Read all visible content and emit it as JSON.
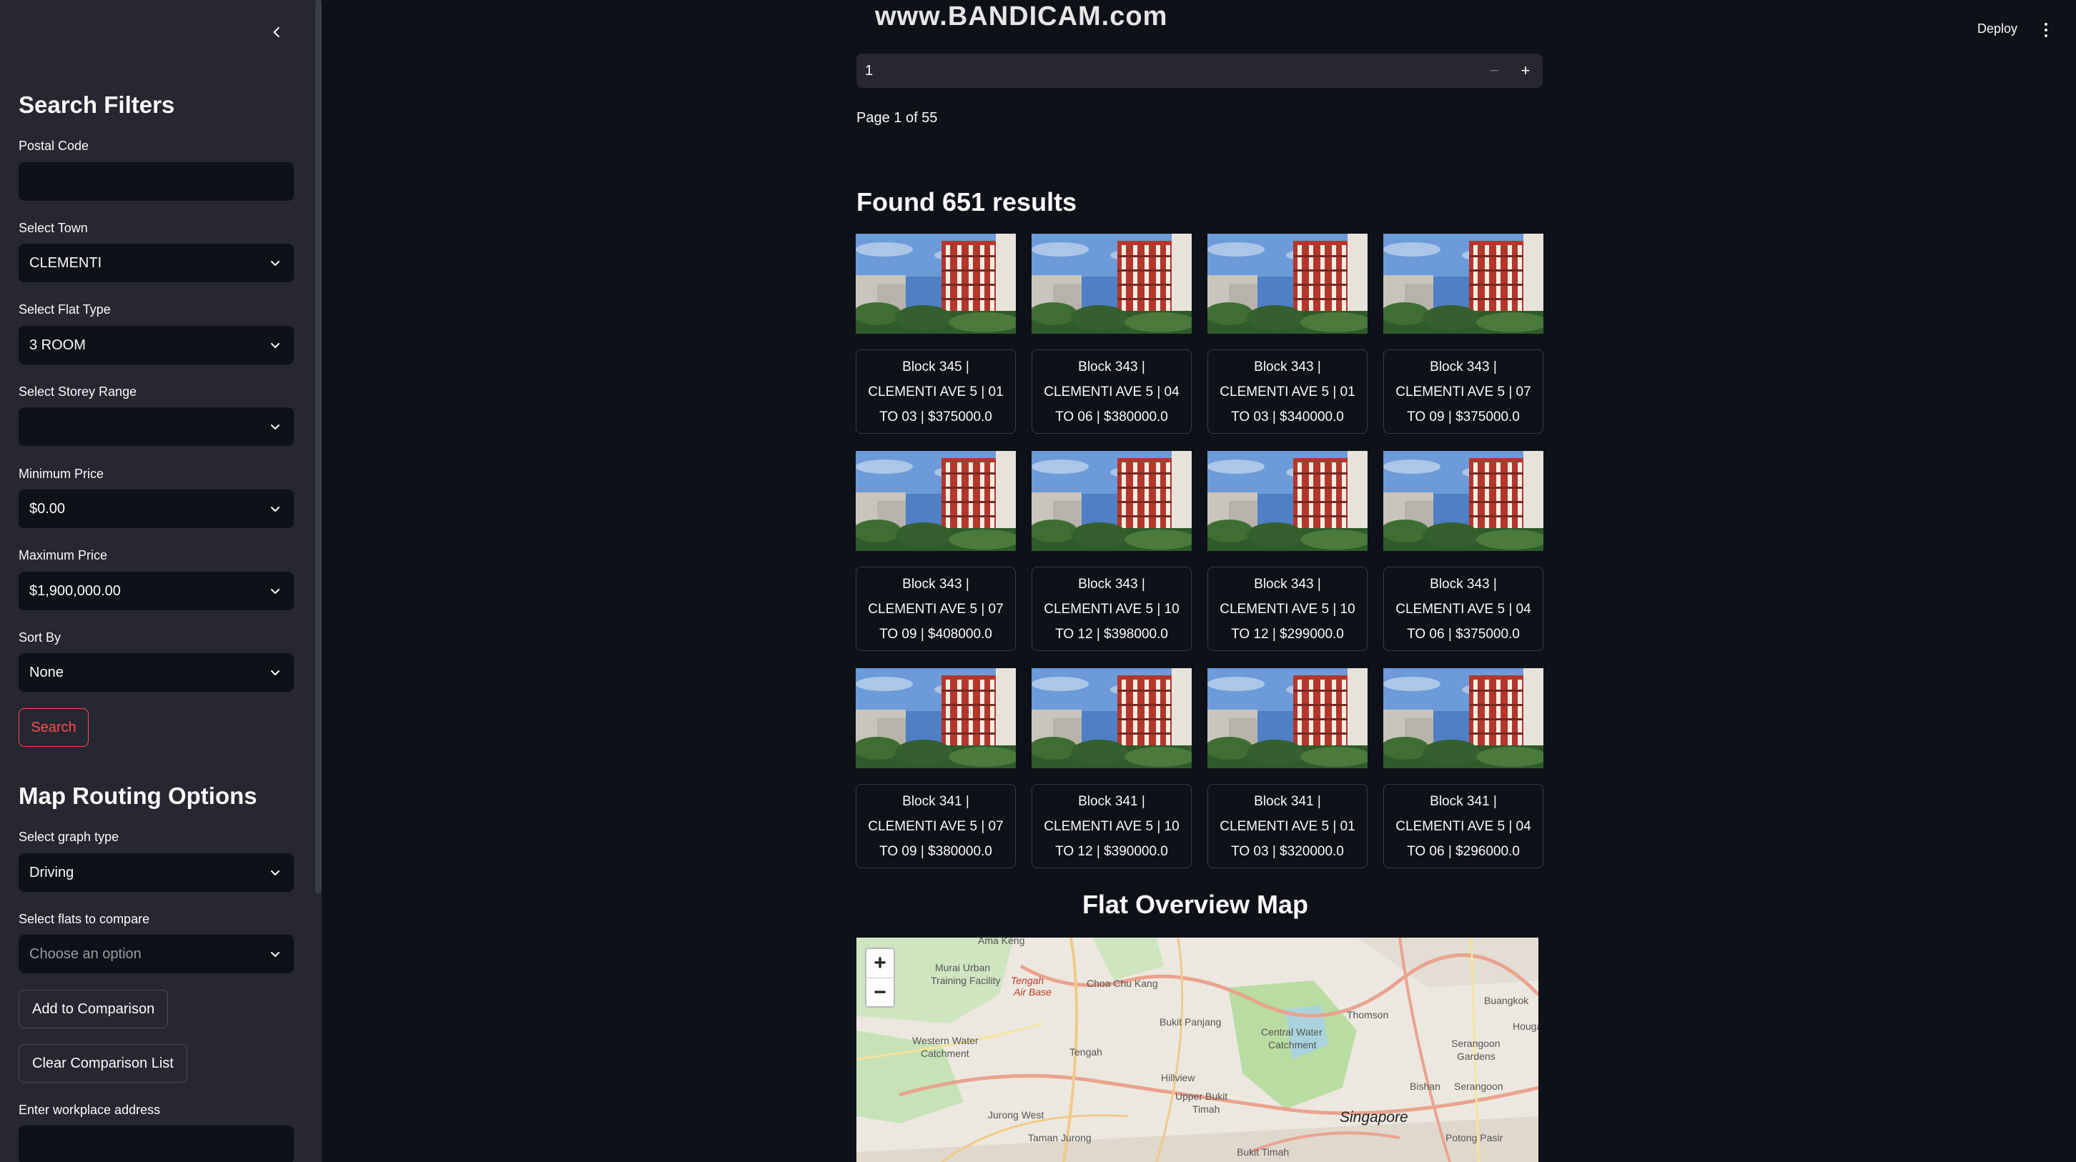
{
  "watermark": "www.BANDICAM.com",
  "header": {
    "deploy_label": "Deploy"
  },
  "sidebar": {
    "heading": "Search Filters",
    "postal_code_label": "Postal Code",
    "postal_code_value": "",
    "town_label": "Select Town",
    "town_value": "CLEMENTI",
    "flat_type_label": "Select Flat Type",
    "flat_type_value": "3 ROOM",
    "storey_label": "Select Storey Range",
    "storey_value": "",
    "min_price_label": "Minimum Price",
    "min_price_value": "$0.00",
    "max_price_label": "Maximum Price",
    "max_price_value": "$1,900,000.00",
    "sort_label": "Sort By",
    "sort_value": "None",
    "search_button": "Search",
    "routing_heading": "Map Routing Options",
    "graph_label": "Select graph type",
    "graph_value": "Driving",
    "compare_label": "Select flats to compare",
    "compare_placeholder": "Choose an option",
    "add_button": "Add to Comparison",
    "clear_button": "Clear Comparison List",
    "workplace_label": "Enter workplace address",
    "workplace_value": ""
  },
  "main": {
    "page_number": "1",
    "page_text": "Page 1 of 55",
    "found_text": "Found 651 results",
    "results": [
      {
        "line1": "Block 345 |",
        "line2": "CLEMENTI AVE 5 | 01",
        "line3": "TO 03 | $375000.0"
      },
      {
        "line1": "Block 343 |",
        "line2": "CLEMENTI AVE 5 | 04",
        "line3": "TO 06 | $380000.0"
      },
      {
        "line1": "Block 343 |",
        "line2": "CLEMENTI AVE 5 | 01",
        "line3": "TO 03 | $340000.0"
      },
      {
        "line1": "Block 343 |",
        "line2": "CLEMENTI AVE 5 | 07",
        "line3": "TO 09 | $375000.0"
      },
      {
        "line1": "Block 343 |",
        "line2": "CLEMENTI AVE 5 | 07",
        "line3": "TO 09 | $408000.0"
      },
      {
        "line1": "Block 343 |",
        "line2": "CLEMENTI AVE 5 | 10",
        "line3": "TO 12 | $398000.0"
      },
      {
        "line1": "Block 343 |",
        "line2": "CLEMENTI AVE 5 | 10",
        "line3": "TO 12 | $299000.0"
      },
      {
        "line1": "Block 343 |",
        "line2": "CLEMENTI AVE 5 | 04",
        "line3": "TO 06 | $375000.0"
      },
      {
        "line1": "Block 341 |",
        "line2": "CLEMENTI AVE 5 | 07",
        "line3": "TO 09 | $380000.0"
      },
      {
        "line1": "Block 341 |",
        "line2": "CLEMENTI AVE 5 | 10",
        "line3": "TO 12 | $390000.0"
      },
      {
        "line1": "Block 341 |",
        "line2": "CLEMENTI AVE 5 | 01",
        "line3": "TO 03 | $320000.0"
      },
      {
        "line1": "Block 341 |",
        "line2": "CLEMENTI AVE 5 | 04",
        "line3": "TO 06 | $296000.0"
      }
    ],
    "map_title": "Flat Overview Map",
    "map": {
      "zoom_in": "+",
      "zoom_out": "−",
      "labels": [
        "Ama Keng",
        "Murai Urban",
        "Training Facility",
        "Tengah",
        "Air Base",
        "Choa Chu Kang",
        "Bukit Panjang",
        "Western Water",
        "Catchment",
        "Tengah",
        "Hillview",
        "Central Water",
        "Catchment",
        "Thomson",
        "Buangkok",
        "Houga",
        "Serangoon",
        "Gardens",
        "Jurong West",
        "Upper Bukit",
        "Timah",
        "Bishan",
        "Serangoon",
        "Singapore",
        "Taman Jurong",
        "Bukit Timah",
        "Potong Pasir"
      ]
    }
  },
  "colors": {
    "background": "#0e1117",
    "sidebar": "#262730",
    "accent": "#ff4b4b"
  }
}
